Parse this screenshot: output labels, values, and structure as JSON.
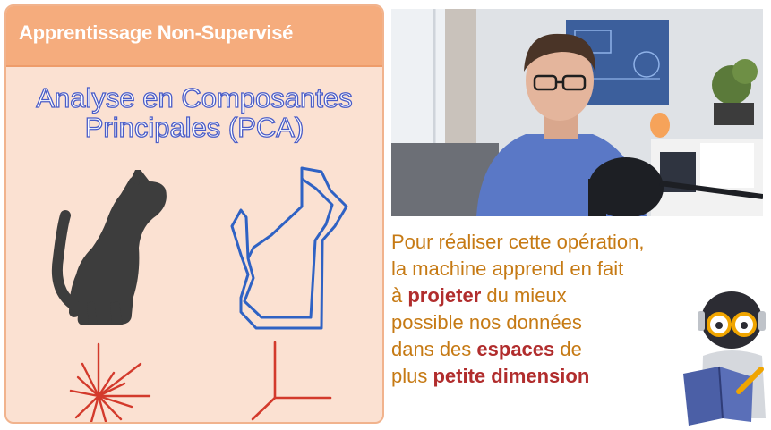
{
  "slide": {
    "header": "Apprentissage Non-Supervisé",
    "title_line1": "Analyse en Composantes",
    "title_line2": "Principales (PCA)"
  },
  "caption": {
    "l1": "Pour réaliser cette opération,",
    "l2": "la machine apprend en fait",
    "l3_pre": "à ",
    "l3_hl": "projeter",
    "l3_post": " du mieux",
    "l4": "possible nos données",
    "l5_pre": "dans des ",
    "l5_hl": "espaces",
    "l5_post": " de",
    "l6_pre": "plus ",
    "l6_hl": "petite dimension"
  },
  "colors": {
    "header_bg": "#f5ac7d",
    "slide_bg": "#fbe1d2",
    "title_stroke": "#4a5cc7",
    "cat_fill": "#3d3d3d",
    "cat_outline": "#2f62c4",
    "axes_red": "#d33a2c",
    "caption_text": "#c67a14",
    "caption_highlight": "#b12d2d"
  },
  "icons": [
    "cat-silhouette-icon",
    "cat-outline-icon",
    "many-axes-icon",
    "three-axes-icon",
    "robot-reading-icon",
    "presenter-video"
  ]
}
